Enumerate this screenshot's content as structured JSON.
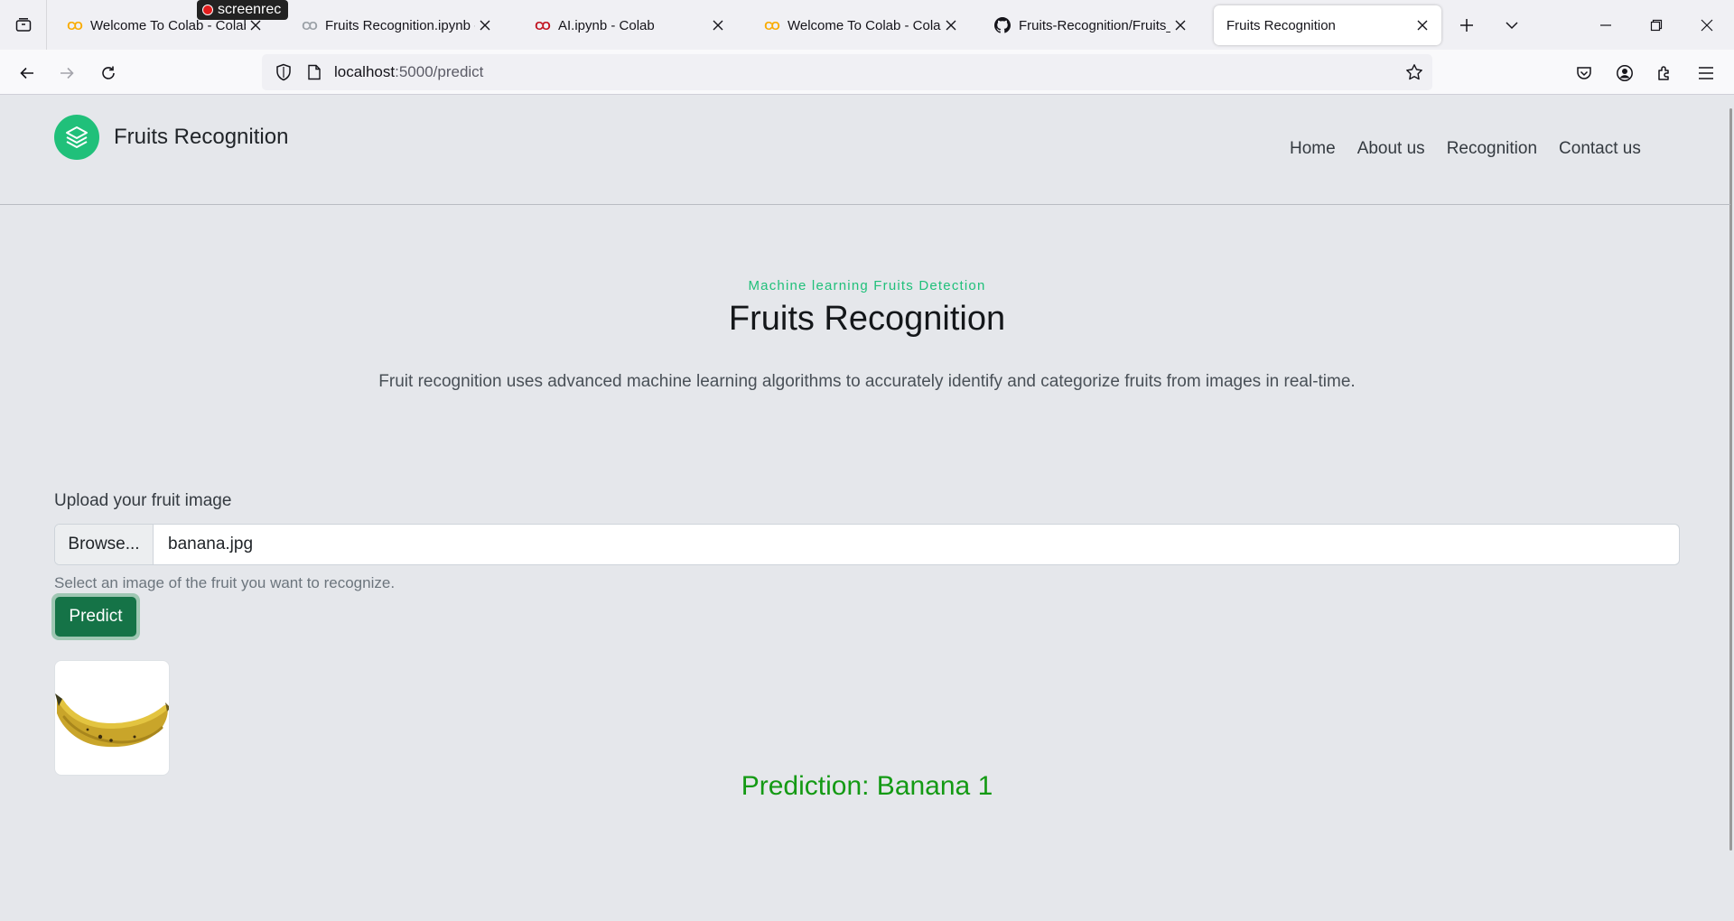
{
  "browser": {
    "tabs": [
      {
        "title": "Welcome To Colab - Colab",
        "favicon": "colab-icon"
      },
      {
        "title": "Fruits Recognition.ipynb - C",
        "favicon": "colab-icon"
      },
      {
        "title": "AI.ipynb - Colab",
        "favicon": "colab-icon"
      },
      {
        "title": "Welcome To Colab - Colab",
        "favicon": "colab-icon"
      },
      {
        "title": "Fruits-Recognition/Fruits_Re",
        "favicon": "github-icon"
      },
      {
        "title": "Fruits Recognition",
        "favicon": "none",
        "active": true
      }
    ],
    "recorder_badge": "screenrec",
    "url_host": "localhost",
    "url_path": ":5000/predict"
  },
  "site": {
    "brand": "Fruits Recognition",
    "nav": [
      "Home",
      "About us",
      "Recognition",
      "Contact us"
    ]
  },
  "hero": {
    "eyebrow": "Machine learning Fruits Detection",
    "title": "Fruits Recognition",
    "description": "Fruit recognition uses advanced machine learning algorithms to accurately identify and categorize fruits from images in real-time."
  },
  "form": {
    "label": "Upload your fruit image",
    "browse_label": "Browse...",
    "file_name": "banana.jpg",
    "help": "Select an image of the fruit you want to recognize.",
    "submit_label": "Predict"
  },
  "result": {
    "prediction": "Prediction: Banana 1"
  },
  "colors": {
    "accent": "#20c07a",
    "button": "#157347",
    "prediction": "#149a14"
  }
}
